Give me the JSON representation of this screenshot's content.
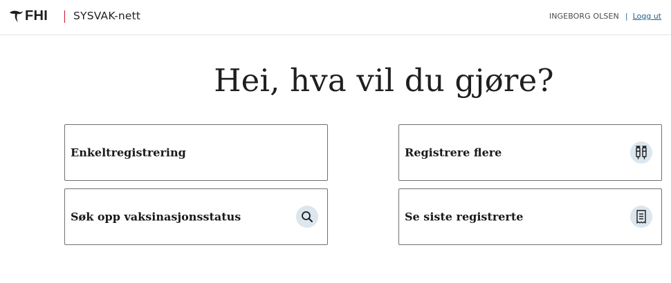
{
  "header": {
    "logo_text": "FHI",
    "app_name": "SYSVAK-nett",
    "user_name": "INGEBORG OLSEN",
    "separator": "|",
    "logout_label": "Logg ut",
    "accent_color": "#c8102e"
  },
  "main": {
    "title": "Hei, hva vil du gjøre?",
    "cards": [
      {
        "label": "Enkeltregistrering",
        "icon": null
      },
      {
        "label": "Registrere flere",
        "icon": "vaccine-vials-icon"
      },
      {
        "label": "Søk opp vaksinasjonsstatus",
        "icon": "search-icon"
      },
      {
        "label": "Se siste registrerte",
        "icon": "receipt-list-icon"
      }
    ]
  },
  "colors": {
    "icon_bg": "#dbe6ee",
    "link": "#1f5d8c",
    "card_border": "#6f6f6f"
  }
}
